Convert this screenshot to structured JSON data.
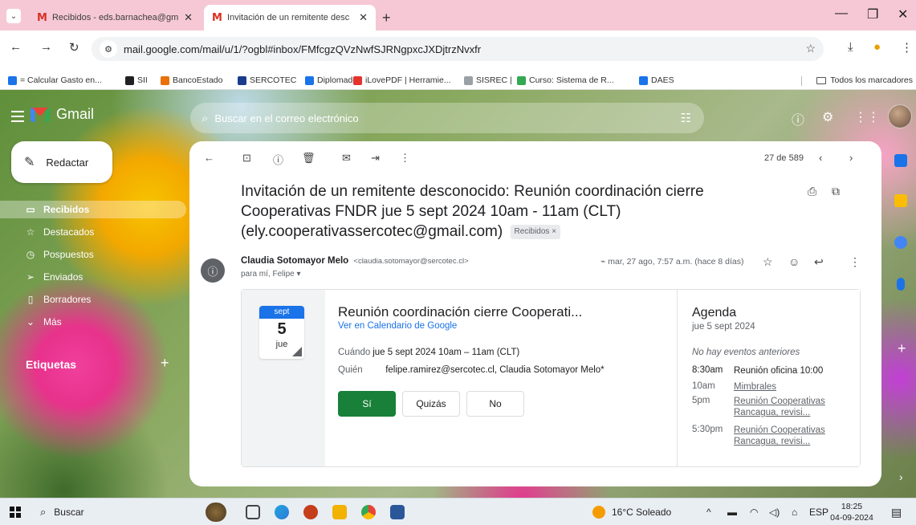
{
  "browser": {
    "tabs": [
      {
        "label": "Recibidos - eds.barnachea@gm",
        "icon": "gmail-icon"
      },
      {
        "label": "Invitación de un remitente desc",
        "icon": "gmail-icon"
      }
    ],
    "url": "mail.google.com/mail/u/1/?ogbl#inbox/FMfcgzQVzNwfSJRNgpxcJXDjtrzNvxfr",
    "bookmarks": [
      {
        "label": "= Calcular Gasto en...",
        "color": "#1a73e8"
      },
      {
        "label": "SII",
        "color": "#202124"
      },
      {
        "label": "BancoEstado",
        "color": "#e8710a"
      },
      {
        "label": "SERCOTEC",
        "color": "#1a3c8c"
      },
      {
        "label": "Diplomado",
        "color": "#1a73e8"
      },
      {
        "label": "iLovePDF | Herramie...",
        "color": "#e5322d"
      },
      {
        "label": "SISREC |",
        "color": "#9aa0a6"
      },
      {
        "label": "Curso: Sistema de R...",
        "color": "#34a853"
      },
      {
        "label": "DAES",
        "color": "#1a73e8"
      }
    ],
    "all_bookmarks": "Todos los marcadores"
  },
  "gmail": {
    "logo_text": "Gmail",
    "search_placeholder": "Buscar en el correo electrónico",
    "compose_label": "Redactar",
    "sidebar": [
      {
        "label": "Recibidos",
        "icon": "inbox-icon",
        "selected": true
      },
      {
        "label": "Destacados",
        "icon": "star-icon",
        "selected": false
      },
      {
        "label": "Pospuestos",
        "icon": "clock-icon",
        "selected": false
      },
      {
        "label": "Enviados",
        "icon": "send-icon",
        "selected": false
      },
      {
        "label": "Borradores",
        "icon": "draft-icon",
        "selected": false
      },
      {
        "label": "Más",
        "icon": "chevron-down-icon",
        "selected": false
      }
    ],
    "labels_heading": "Etiquetas",
    "toolbar_counter": "27 de 589",
    "subject": "Invitación de un remitente desconocido: Reunión coordinación cierre Cooperativas FNDR jue 5 sept 2024 10am - 11am (CLT) (ely.cooperativassercotec@gmail.com)",
    "subject_chip": "Recibidos ×",
    "sender_name": "Claudia Sotomayor Melo",
    "sender_email": "<claudia.sotomayor@sercotec.cl>",
    "recipients": "para mí, Felipe ▾",
    "date": "mar, 27 ago, 7:57 a.m. (hace 8 días)",
    "invite": {
      "month": "sept",
      "day": "5",
      "weekday": "jue",
      "title": "Reunión coordinación cierre Cooperati...",
      "calendar_link": "Ver en Calendario de Google",
      "when_label": "Cuándo",
      "when_value": "jue 5 sept 2024 10am – 11am (CLT)",
      "who_label": "Quién",
      "who_value": "felipe.ramirez@sercotec.cl, Claudia Sotomayor Melo*",
      "rsvp_yes": "Sí",
      "rsvp_maybe": "Quizás",
      "rsvp_no": "No"
    },
    "agenda": {
      "title": "Agenda",
      "date": "jue 5 sept 2024",
      "no_previous": "No hay eventos anteriores",
      "events": [
        {
          "time": "8:30am",
          "name": "Reunión oficina 10:00"
        },
        {
          "time": "10am",
          "name": "Mimbrales"
        },
        {
          "time": "5pm",
          "name": "Reunión Cooperativas Rancagua, revisi..."
        },
        {
          "time": "5:30pm",
          "name": "Reunión Cooperativas Rancagua, revisi..."
        }
      ]
    }
  },
  "taskbar": {
    "search_label": "Buscar",
    "weather": "16°C Soleado",
    "language": "ESP",
    "time": "18:25",
    "date": "04-09-2024"
  }
}
